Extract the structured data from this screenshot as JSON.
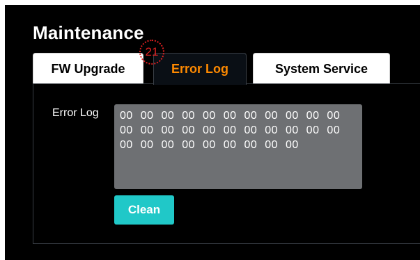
{
  "page_title": "Maintenance",
  "tabs": [
    {
      "label": "FW Upgrade",
      "active": false
    },
    {
      "label": "Error Log",
      "active": true
    },
    {
      "label": "System Service",
      "active": false
    }
  ],
  "annotation_marker": "21",
  "error_log": {
    "label": "Error Log",
    "value": "00 00 00 00 00 00 00 00 00 00 00 00 00 00 00 00 00 00 00 00 00 00 00 00 00 00 00 00 00 00 00",
    "clean_label": "Clean"
  },
  "colors": {
    "background": "#000000",
    "active_tab_text": "#ff8a00",
    "log_box": "#6e7073",
    "clean_button": "#20c8c8",
    "marker": "#e02020"
  }
}
